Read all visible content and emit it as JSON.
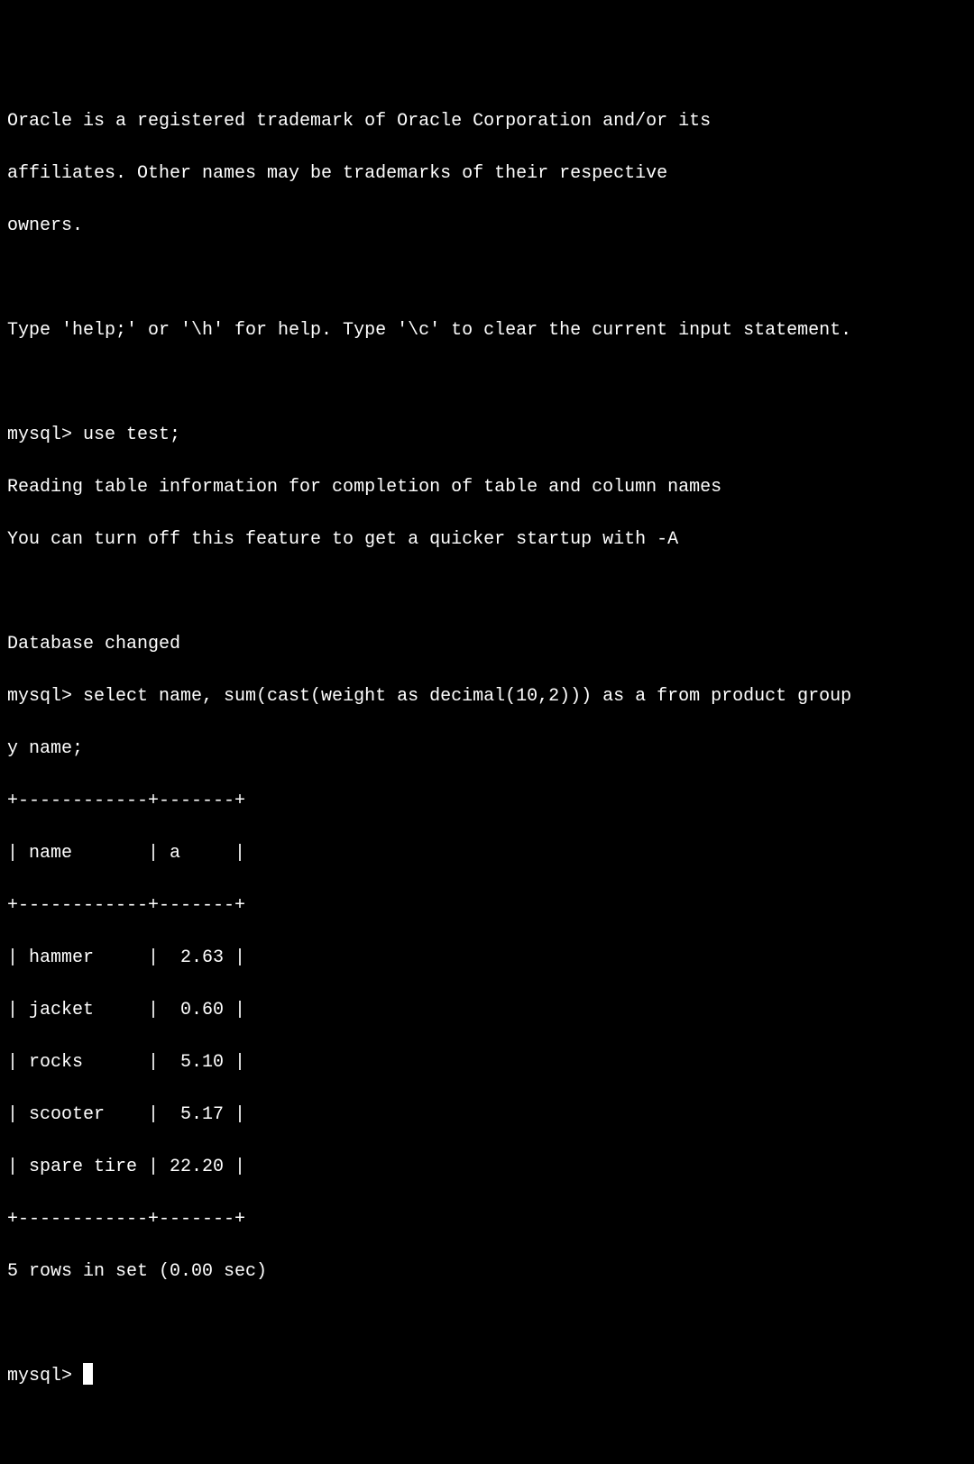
{
  "intro": {
    "trademark1": "Oracle is a registered trademark of Oracle Corporation and/or its",
    "trademark2": "affiliates. Other names may be trademarks of their respective",
    "trademark3": "owners.",
    "help": "Type 'help;' or '\\h' for help. Type '\\c' to clear the current input statement."
  },
  "prompt": "mysql> ",
  "commands": {
    "use_test": "use test;",
    "reading1": "Reading table information for completion of table and column names",
    "reading2": "You can turn off this feature to get a quicker startup with -A",
    "db_changed": "Database changed",
    "select1": "select name, sum(cast(weight as decimal(10,2))) as a from product group",
    "select2": "y name;"
  },
  "table": {
    "border": "+------------+-------+",
    "header": "| name       | a     |",
    "rows": [
      "| hammer     |  2.63 |",
      "| jacket     |  0.60 |",
      "| rocks      |  5.10 |",
      "| scooter    |  5.17 |",
      "| spare tire | 22.20 |"
    ],
    "footer": "5 rows in set (0.00 sec)"
  },
  "chart_data": {
    "type": "table",
    "columns": [
      "name",
      "a"
    ],
    "rows": [
      {
        "name": "hammer",
        "a": 2.63
      },
      {
        "name": "jacket",
        "a": 0.6
      },
      {
        "name": "rocks",
        "a": 5.1
      },
      {
        "name": "scooter",
        "a": 5.17
      },
      {
        "name": "spare tire",
        "a": 22.2
      }
    ],
    "row_count": 5,
    "duration_sec": 0.0
  }
}
